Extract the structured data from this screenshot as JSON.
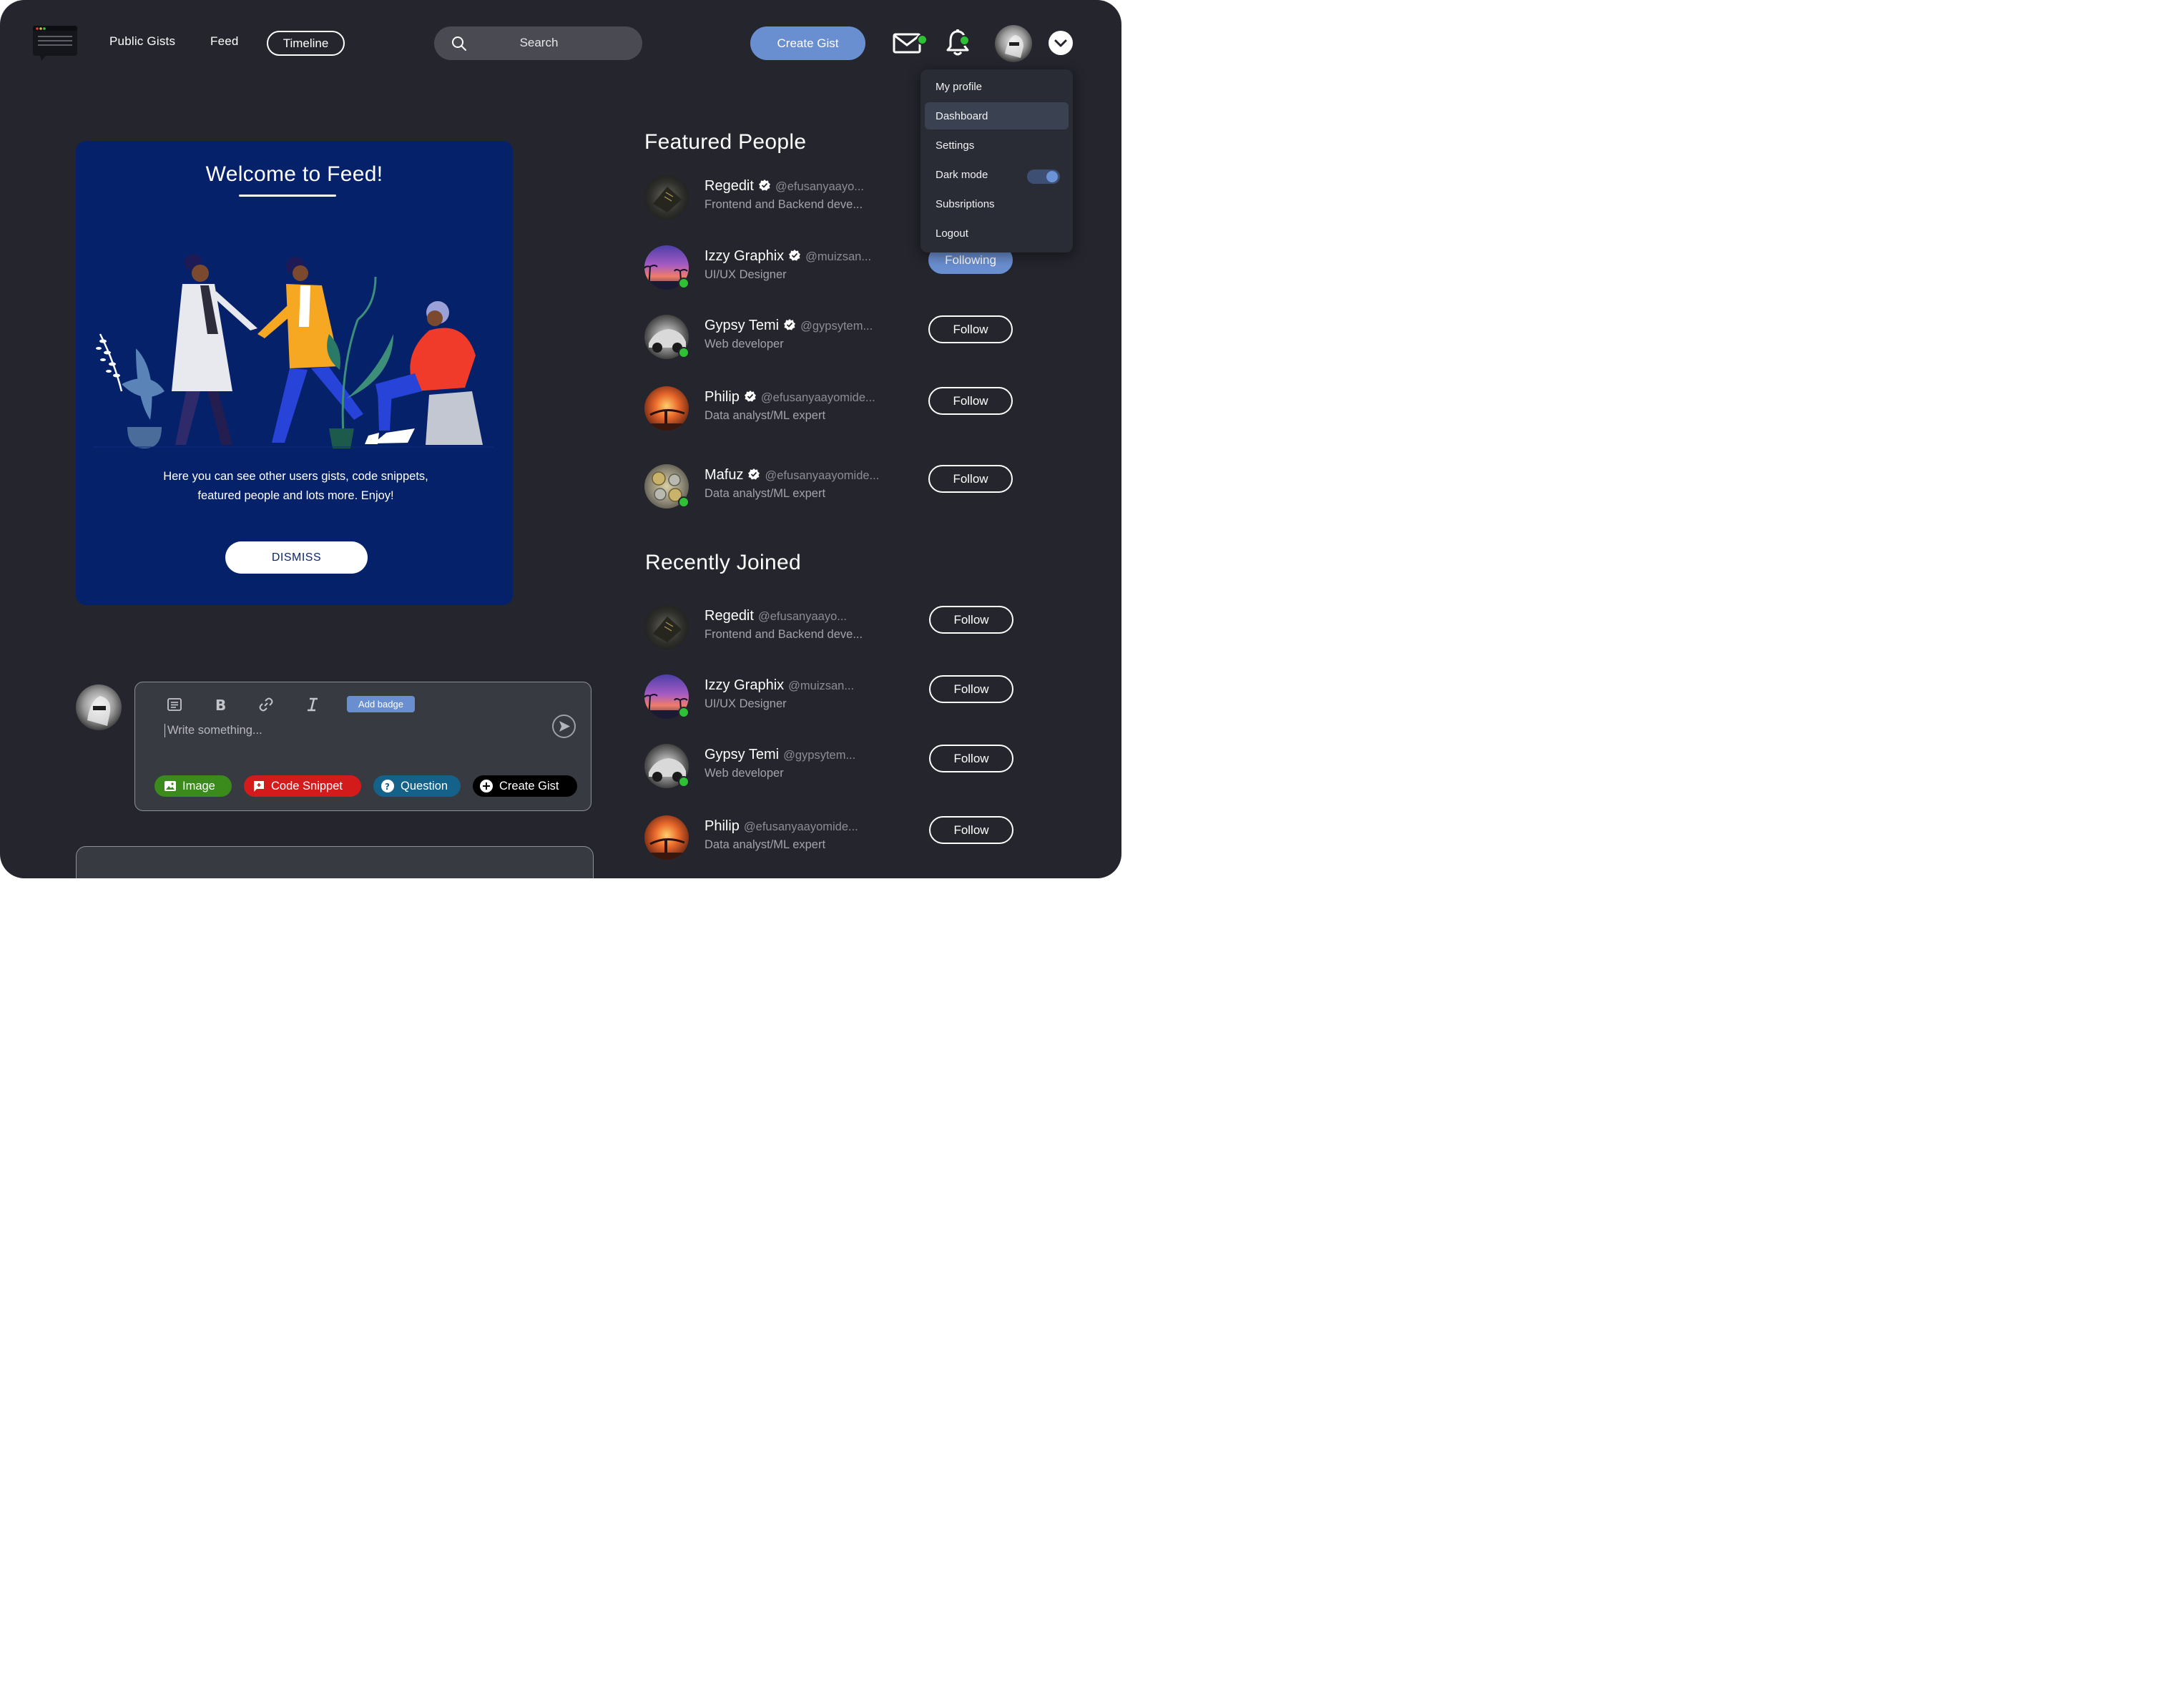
{
  "header": {
    "nav": [
      "Public Gists",
      "Feed",
      "Timeline"
    ],
    "active_nav": "Timeline",
    "search_placeholder": "Search",
    "create_button": "Create Gist",
    "accent_color": "#6a8fd1"
  },
  "dropdown": {
    "items": [
      "My profile",
      "Dashboard",
      "Settings",
      "Dark mode",
      "Subsriptions",
      "Logout"
    ],
    "active": "Dashboard",
    "dark_mode_on": true
  },
  "welcome": {
    "title": "Welcome to Feed!",
    "description": "Here you can see other users gists, code snippets, featured people and lots more. Enjoy!",
    "dismiss": "DISMISS"
  },
  "composer": {
    "add_badge": "Add badge",
    "placeholder": "Write something...",
    "chips": [
      {
        "label": "Image",
        "color": "#3a8a1c"
      },
      {
        "label": "Code Snippet",
        "color": "#d31b1b"
      },
      {
        "label": "Question",
        "color": "#14628a"
      },
      {
        "label": "Create Gist",
        "color": "#000000"
      }
    ]
  },
  "featured": {
    "title": "Featured People",
    "people": [
      {
        "name": "Regedit",
        "verified": true,
        "handle": "@efusanyaayo...",
        "role": "Frontend and Backend deve...",
        "online": false,
        "action": ""
      },
      {
        "name": "Izzy Graphix",
        "verified": true,
        "handle": "@muizsan...",
        "role": "UI/UX Designer",
        "online": true,
        "action": "Following"
      },
      {
        "name": "Gypsy Temi",
        "verified": true,
        "handle": "@gypsytem...",
        "role": "Web developer",
        "online": true,
        "action": "Follow"
      },
      {
        "name": "Philip",
        "verified": true,
        "handle": "@efusanyaayomide...",
        "role": "Data analyst/ML expert",
        "online": false,
        "action": "Follow"
      },
      {
        "name": "Mafuz",
        "verified": true,
        "handle": "@efusanyaayomide...",
        "role": "Data analyst/ML expert",
        "online": true,
        "action": "Follow"
      }
    ]
  },
  "recent": {
    "title": "Recently Joined",
    "people": [
      {
        "name": "Regedit",
        "handle": "@efusanyaayo...",
        "role": "Frontend and Backend deve...",
        "online": false,
        "action": "Follow"
      },
      {
        "name": "Izzy Graphix",
        "handle": "@muizsan...",
        "role": "UI/UX Designer",
        "online": true,
        "action": "Follow"
      },
      {
        "name": "Gypsy Temi",
        "handle": "@gypsytem...",
        "role": "Web developer",
        "online": true,
        "action": "Follow"
      },
      {
        "name": "Philip",
        "handle": "@efusanyaayomide...",
        "role": "Data analyst/ML expert",
        "online": false,
        "action": "Follow"
      }
    ]
  }
}
